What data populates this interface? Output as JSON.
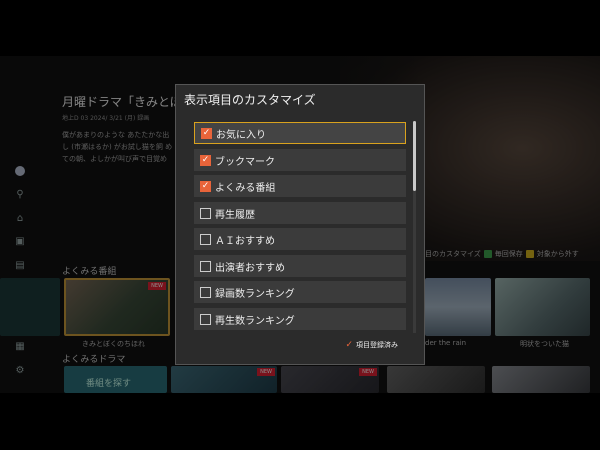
{
  "hero": {
    "title": "月曜ドラマ「きみとぼく",
    "meta": "地上D 03    2024/ 3/21 (月)  録画",
    "description": "僕があまりのような あたたかな出 し (市瀬はるか) がお試し猫を飼 めての朝、よしかが叫び声で目覚め"
  },
  "sidebar": {
    "icons": [
      "profile-icon",
      "search-icon",
      "home-icon",
      "recordings-icon",
      "film-icon",
      "grid-icon",
      "settings-icon"
    ]
  },
  "sections": {
    "watched_label": "よくみる番組",
    "drama_label": "よくみるドラマ"
  },
  "hints": {
    "customize": "項目のカスタマイズ",
    "save": "毎回保存",
    "schedule": "対象から外す",
    "colors": {
      "green": "#3fa34d",
      "yellow": "#d4b21e"
    }
  },
  "thumbnails": {
    "first_caption": "きみとぼくのちほれ",
    "new_badge": "NEW",
    "captions_right": [
      "der the rain",
      "明状をついた猫"
    ]
  },
  "row2": {
    "placeholder_text": "番組を探す",
    "new_badge": "NEW"
  },
  "dialog": {
    "title": "表示項目のカスタマイズ",
    "items": [
      {
        "label": "お気に入り",
        "checked": true
      },
      {
        "label": "ブックマーク",
        "checked": true
      },
      {
        "label": "よくみる番組",
        "checked": true
      },
      {
        "label": "再生履歴",
        "checked": false
      },
      {
        "label": "ＡＩおすすめ",
        "checked": false
      },
      {
        "label": "出演者おすすめ",
        "checked": false
      },
      {
        "label": "録画数ランキング",
        "checked": false
      },
      {
        "label": "再生数ランキング",
        "checked": false
      }
    ],
    "focused_index": 0,
    "check_glyph": "✓",
    "footer_label": "項目登録済み",
    "accent_color": "#e8643a",
    "focus_color": "#d9a21e"
  }
}
